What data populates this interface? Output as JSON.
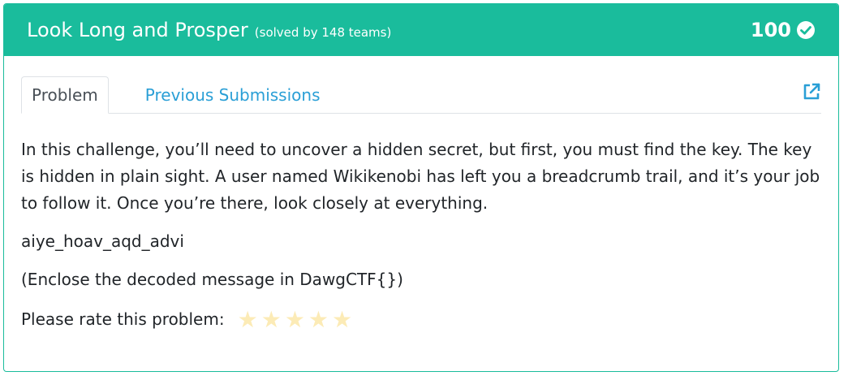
{
  "header": {
    "title": "Look Long and Prosper",
    "solved": "(solved by 148 teams)",
    "points": "100",
    "check_icon": "check-circle-icon"
  },
  "tabs": {
    "problem": "Problem",
    "previous": "Previous Submissions",
    "external_icon": "external-link-icon"
  },
  "content": {
    "description": "In this challenge, you’ll need to uncover a hidden secret, but first, you must find the key. The key is hidden in plain sight. A user named Wikikenobi has left you a breadcrumb trail, and it’s your job to follow it. Once you’re there, look closely at everything.",
    "cipher": "aiye_hoav_aqd_advi",
    "hint": "(Enclose the decoded message in DawgCTF{})",
    "rating_label": "Please rate this problem:"
  },
  "rating": {
    "stars": 5,
    "filled": 0
  },
  "colors": {
    "accent": "#1abc9c",
    "link": "#2a9fd6",
    "star": "#fcebb6"
  }
}
